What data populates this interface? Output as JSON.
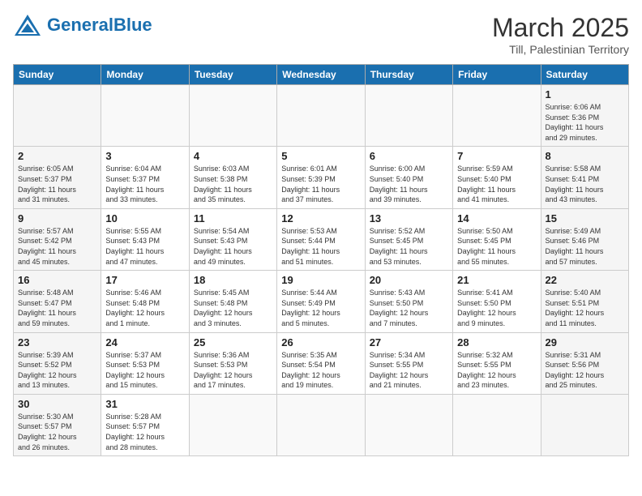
{
  "header": {
    "logo_general": "General",
    "logo_blue": "Blue",
    "month_title": "March 2025",
    "subtitle": "Till, Palestinian Territory"
  },
  "days_of_week": [
    "Sunday",
    "Monday",
    "Tuesday",
    "Wednesday",
    "Thursday",
    "Friday",
    "Saturday"
  ],
  "weeks": [
    [
      {
        "day": "",
        "text": ""
      },
      {
        "day": "",
        "text": ""
      },
      {
        "day": "",
        "text": ""
      },
      {
        "day": "",
        "text": ""
      },
      {
        "day": "",
        "text": ""
      },
      {
        "day": "",
        "text": ""
      },
      {
        "day": "1",
        "text": "Sunrise: 6:06 AM\nSunset: 5:36 PM\nDaylight: 11 hours\nand 29 minutes."
      }
    ],
    [
      {
        "day": "2",
        "text": "Sunrise: 6:05 AM\nSunset: 5:37 PM\nDaylight: 11 hours\nand 31 minutes."
      },
      {
        "day": "3",
        "text": "Sunrise: 6:04 AM\nSunset: 5:37 PM\nDaylight: 11 hours\nand 33 minutes."
      },
      {
        "day": "4",
        "text": "Sunrise: 6:03 AM\nSunset: 5:38 PM\nDaylight: 11 hours\nand 35 minutes."
      },
      {
        "day": "5",
        "text": "Sunrise: 6:01 AM\nSunset: 5:39 PM\nDaylight: 11 hours\nand 37 minutes."
      },
      {
        "day": "6",
        "text": "Sunrise: 6:00 AM\nSunset: 5:40 PM\nDaylight: 11 hours\nand 39 minutes."
      },
      {
        "day": "7",
        "text": "Sunrise: 5:59 AM\nSunset: 5:40 PM\nDaylight: 11 hours\nand 41 minutes."
      },
      {
        "day": "8",
        "text": "Sunrise: 5:58 AM\nSunset: 5:41 PM\nDaylight: 11 hours\nand 43 minutes."
      }
    ],
    [
      {
        "day": "9",
        "text": "Sunrise: 5:57 AM\nSunset: 5:42 PM\nDaylight: 11 hours\nand 45 minutes."
      },
      {
        "day": "10",
        "text": "Sunrise: 5:55 AM\nSunset: 5:43 PM\nDaylight: 11 hours\nand 47 minutes."
      },
      {
        "day": "11",
        "text": "Sunrise: 5:54 AM\nSunset: 5:43 PM\nDaylight: 11 hours\nand 49 minutes."
      },
      {
        "day": "12",
        "text": "Sunrise: 5:53 AM\nSunset: 5:44 PM\nDaylight: 11 hours\nand 51 minutes."
      },
      {
        "day": "13",
        "text": "Sunrise: 5:52 AM\nSunset: 5:45 PM\nDaylight: 11 hours\nand 53 minutes."
      },
      {
        "day": "14",
        "text": "Sunrise: 5:50 AM\nSunset: 5:45 PM\nDaylight: 11 hours\nand 55 minutes."
      },
      {
        "day": "15",
        "text": "Sunrise: 5:49 AM\nSunset: 5:46 PM\nDaylight: 11 hours\nand 57 minutes."
      }
    ],
    [
      {
        "day": "16",
        "text": "Sunrise: 5:48 AM\nSunset: 5:47 PM\nDaylight: 11 hours\nand 59 minutes."
      },
      {
        "day": "17",
        "text": "Sunrise: 5:46 AM\nSunset: 5:48 PM\nDaylight: 12 hours\nand 1 minute."
      },
      {
        "day": "18",
        "text": "Sunrise: 5:45 AM\nSunset: 5:48 PM\nDaylight: 12 hours\nand 3 minutes."
      },
      {
        "day": "19",
        "text": "Sunrise: 5:44 AM\nSunset: 5:49 PM\nDaylight: 12 hours\nand 5 minutes."
      },
      {
        "day": "20",
        "text": "Sunrise: 5:43 AM\nSunset: 5:50 PM\nDaylight: 12 hours\nand 7 minutes."
      },
      {
        "day": "21",
        "text": "Sunrise: 5:41 AM\nSunset: 5:50 PM\nDaylight: 12 hours\nand 9 minutes."
      },
      {
        "day": "22",
        "text": "Sunrise: 5:40 AM\nSunset: 5:51 PM\nDaylight: 12 hours\nand 11 minutes."
      }
    ],
    [
      {
        "day": "23",
        "text": "Sunrise: 5:39 AM\nSunset: 5:52 PM\nDaylight: 12 hours\nand 13 minutes."
      },
      {
        "day": "24",
        "text": "Sunrise: 5:37 AM\nSunset: 5:53 PM\nDaylight: 12 hours\nand 15 minutes."
      },
      {
        "day": "25",
        "text": "Sunrise: 5:36 AM\nSunset: 5:53 PM\nDaylight: 12 hours\nand 17 minutes."
      },
      {
        "day": "26",
        "text": "Sunrise: 5:35 AM\nSunset: 5:54 PM\nDaylight: 12 hours\nand 19 minutes."
      },
      {
        "day": "27",
        "text": "Sunrise: 5:34 AM\nSunset: 5:55 PM\nDaylight: 12 hours\nand 21 minutes."
      },
      {
        "day": "28",
        "text": "Sunrise: 5:32 AM\nSunset: 5:55 PM\nDaylight: 12 hours\nand 23 minutes."
      },
      {
        "day": "29",
        "text": "Sunrise: 5:31 AM\nSunset: 5:56 PM\nDaylight: 12 hours\nand 25 minutes."
      }
    ],
    [
      {
        "day": "30",
        "text": "Sunrise: 5:30 AM\nSunset: 5:57 PM\nDaylight: 12 hours\nand 26 minutes."
      },
      {
        "day": "31",
        "text": "Sunrise: 5:28 AM\nSunset: 5:57 PM\nDaylight: 12 hours\nand 28 minutes."
      },
      {
        "day": "",
        "text": ""
      },
      {
        "day": "",
        "text": ""
      },
      {
        "day": "",
        "text": ""
      },
      {
        "day": "",
        "text": ""
      },
      {
        "day": "",
        "text": ""
      }
    ]
  ]
}
